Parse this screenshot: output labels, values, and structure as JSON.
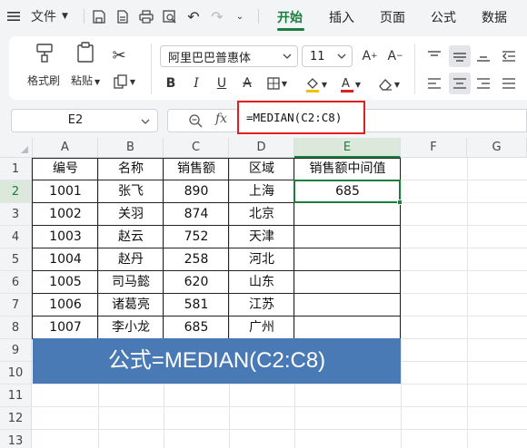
{
  "menubar": {
    "file_label": "文件",
    "tabs": [
      {
        "label": "开始",
        "active": true
      },
      {
        "label": "插入",
        "active": false
      },
      {
        "label": "页面",
        "active": false
      },
      {
        "label": "公式",
        "active": false
      },
      {
        "label": "数据",
        "active": false
      }
    ]
  },
  "ribbon": {
    "format_painter_label": "格式刷",
    "paste_label": "粘贴",
    "font_name": "阿里巴巴普惠体",
    "font_size": "11"
  },
  "formula_bar": {
    "name_box": "E2",
    "fx_label": "fx",
    "formula": "=MEDIAN(C2:C8)"
  },
  "grid": {
    "columns": [
      "A",
      "B",
      "C",
      "D",
      "E",
      "F",
      "G"
    ],
    "rows": [
      "1",
      "2",
      "3",
      "4",
      "5",
      "6",
      "7",
      "8",
      "9",
      "10",
      "11",
      "12",
      "13"
    ],
    "selected_column": "E",
    "selected_row": "2",
    "headers": [
      "编号",
      "名称",
      "销售额",
      "区域",
      "销售额中间值"
    ],
    "data": [
      [
        "1001",
        "张飞",
        "890",
        "上海",
        "685"
      ],
      [
        "1002",
        "关羽",
        "874",
        "北京",
        ""
      ],
      [
        "1003",
        "赵云",
        "752",
        "天津",
        ""
      ],
      [
        "1004",
        "赵丹",
        "258",
        "河北",
        ""
      ],
      [
        "1005",
        "司马懿",
        "620",
        "山东",
        ""
      ],
      [
        "1006",
        "诸葛亮",
        "581",
        "江苏",
        ""
      ],
      [
        "1007",
        "李小龙",
        "685",
        "广州",
        ""
      ]
    ],
    "banner_text": "公式=MEDIAN(C2:C8)"
  },
  "colors": {
    "accent_green": "#1a7f3c",
    "banner_blue": "#4a7ab5",
    "highlight_red": "#e02020"
  }
}
